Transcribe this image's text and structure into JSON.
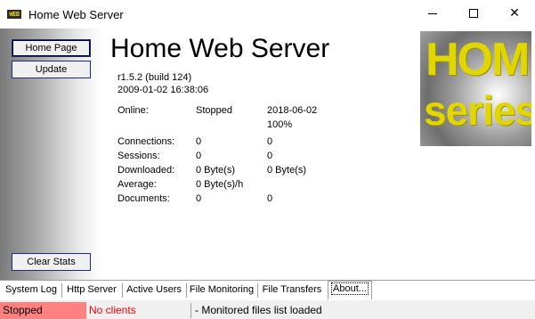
{
  "window": {
    "icon_text": "WEB",
    "title": "Home Web Server"
  },
  "left_panel": {
    "home_page": "Home Page",
    "update": "Update",
    "clear_stats": "Clear Stats"
  },
  "main": {
    "title": "Home Web Server",
    "version": "r1.5.2 (build 124)",
    "build_date": "2009-01-02 16:38:06",
    "online_label": "Online:",
    "online_status": "Stopped",
    "online_date": "2018-06-02",
    "online_percent": "100%",
    "stats": [
      {
        "label": "Connections:",
        "current": "0",
        "total": "0"
      },
      {
        "label": "Sessions:",
        "current": "0",
        "total": "0"
      },
      {
        "label": "Downloaded:",
        "current": "0 Byte(s)",
        "total": "0 Byte(s)"
      },
      {
        "label": "Average:",
        "current": "0 Byte(s)/h",
        "total": ""
      },
      {
        "label": "Documents:",
        "current": "0",
        "total": "0"
      }
    ]
  },
  "logo": {
    "line1": "HOME",
    "line2": "series"
  },
  "tabs": [
    {
      "label": "System Log"
    },
    {
      "label": "Http Server"
    },
    {
      "label": "Active Users"
    },
    {
      "label": "File Monitoring"
    },
    {
      "label": "File Transfers"
    },
    {
      "label": "About..."
    }
  ],
  "status": {
    "server": "Stopped",
    "clients": "No clients",
    "message": "- Monitored files list loaded"
  }
}
